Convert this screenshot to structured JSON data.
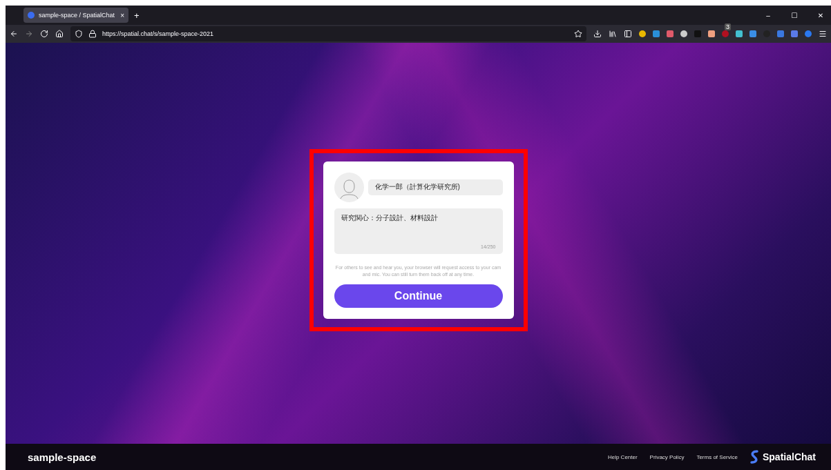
{
  "browser": {
    "tab_title": "sample-space / SpatialChat",
    "tab_close": "×",
    "new_tab": "+",
    "url": "https://spatial.chat/s/sample-space-2021",
    "extension_badge": "3",
    "window_controls": [
      "–",
      "☐",
      "✕"
    ]
  },
  "profile_form": {
    "name": {
      "value": "化学一郎（計算化学研究所)"
    },
    "bio": {
      "value": "研究関心：分子設計、材料設計",
      "counter": "14/250"
    },
    "notice": "For others to see and hear you, your browser will request access to your cam and mic. You can still turn them back off at any time.",
    "continue_button": "Continue",
    "highlighted": true
  },
  "footer": {
    "space_name": "sample-space",
    "links": [
      "Help Center",
      "Privacy Policy",
      "Terms of Service"
    ],
    "brand": "SpatialChat"
  }
}
